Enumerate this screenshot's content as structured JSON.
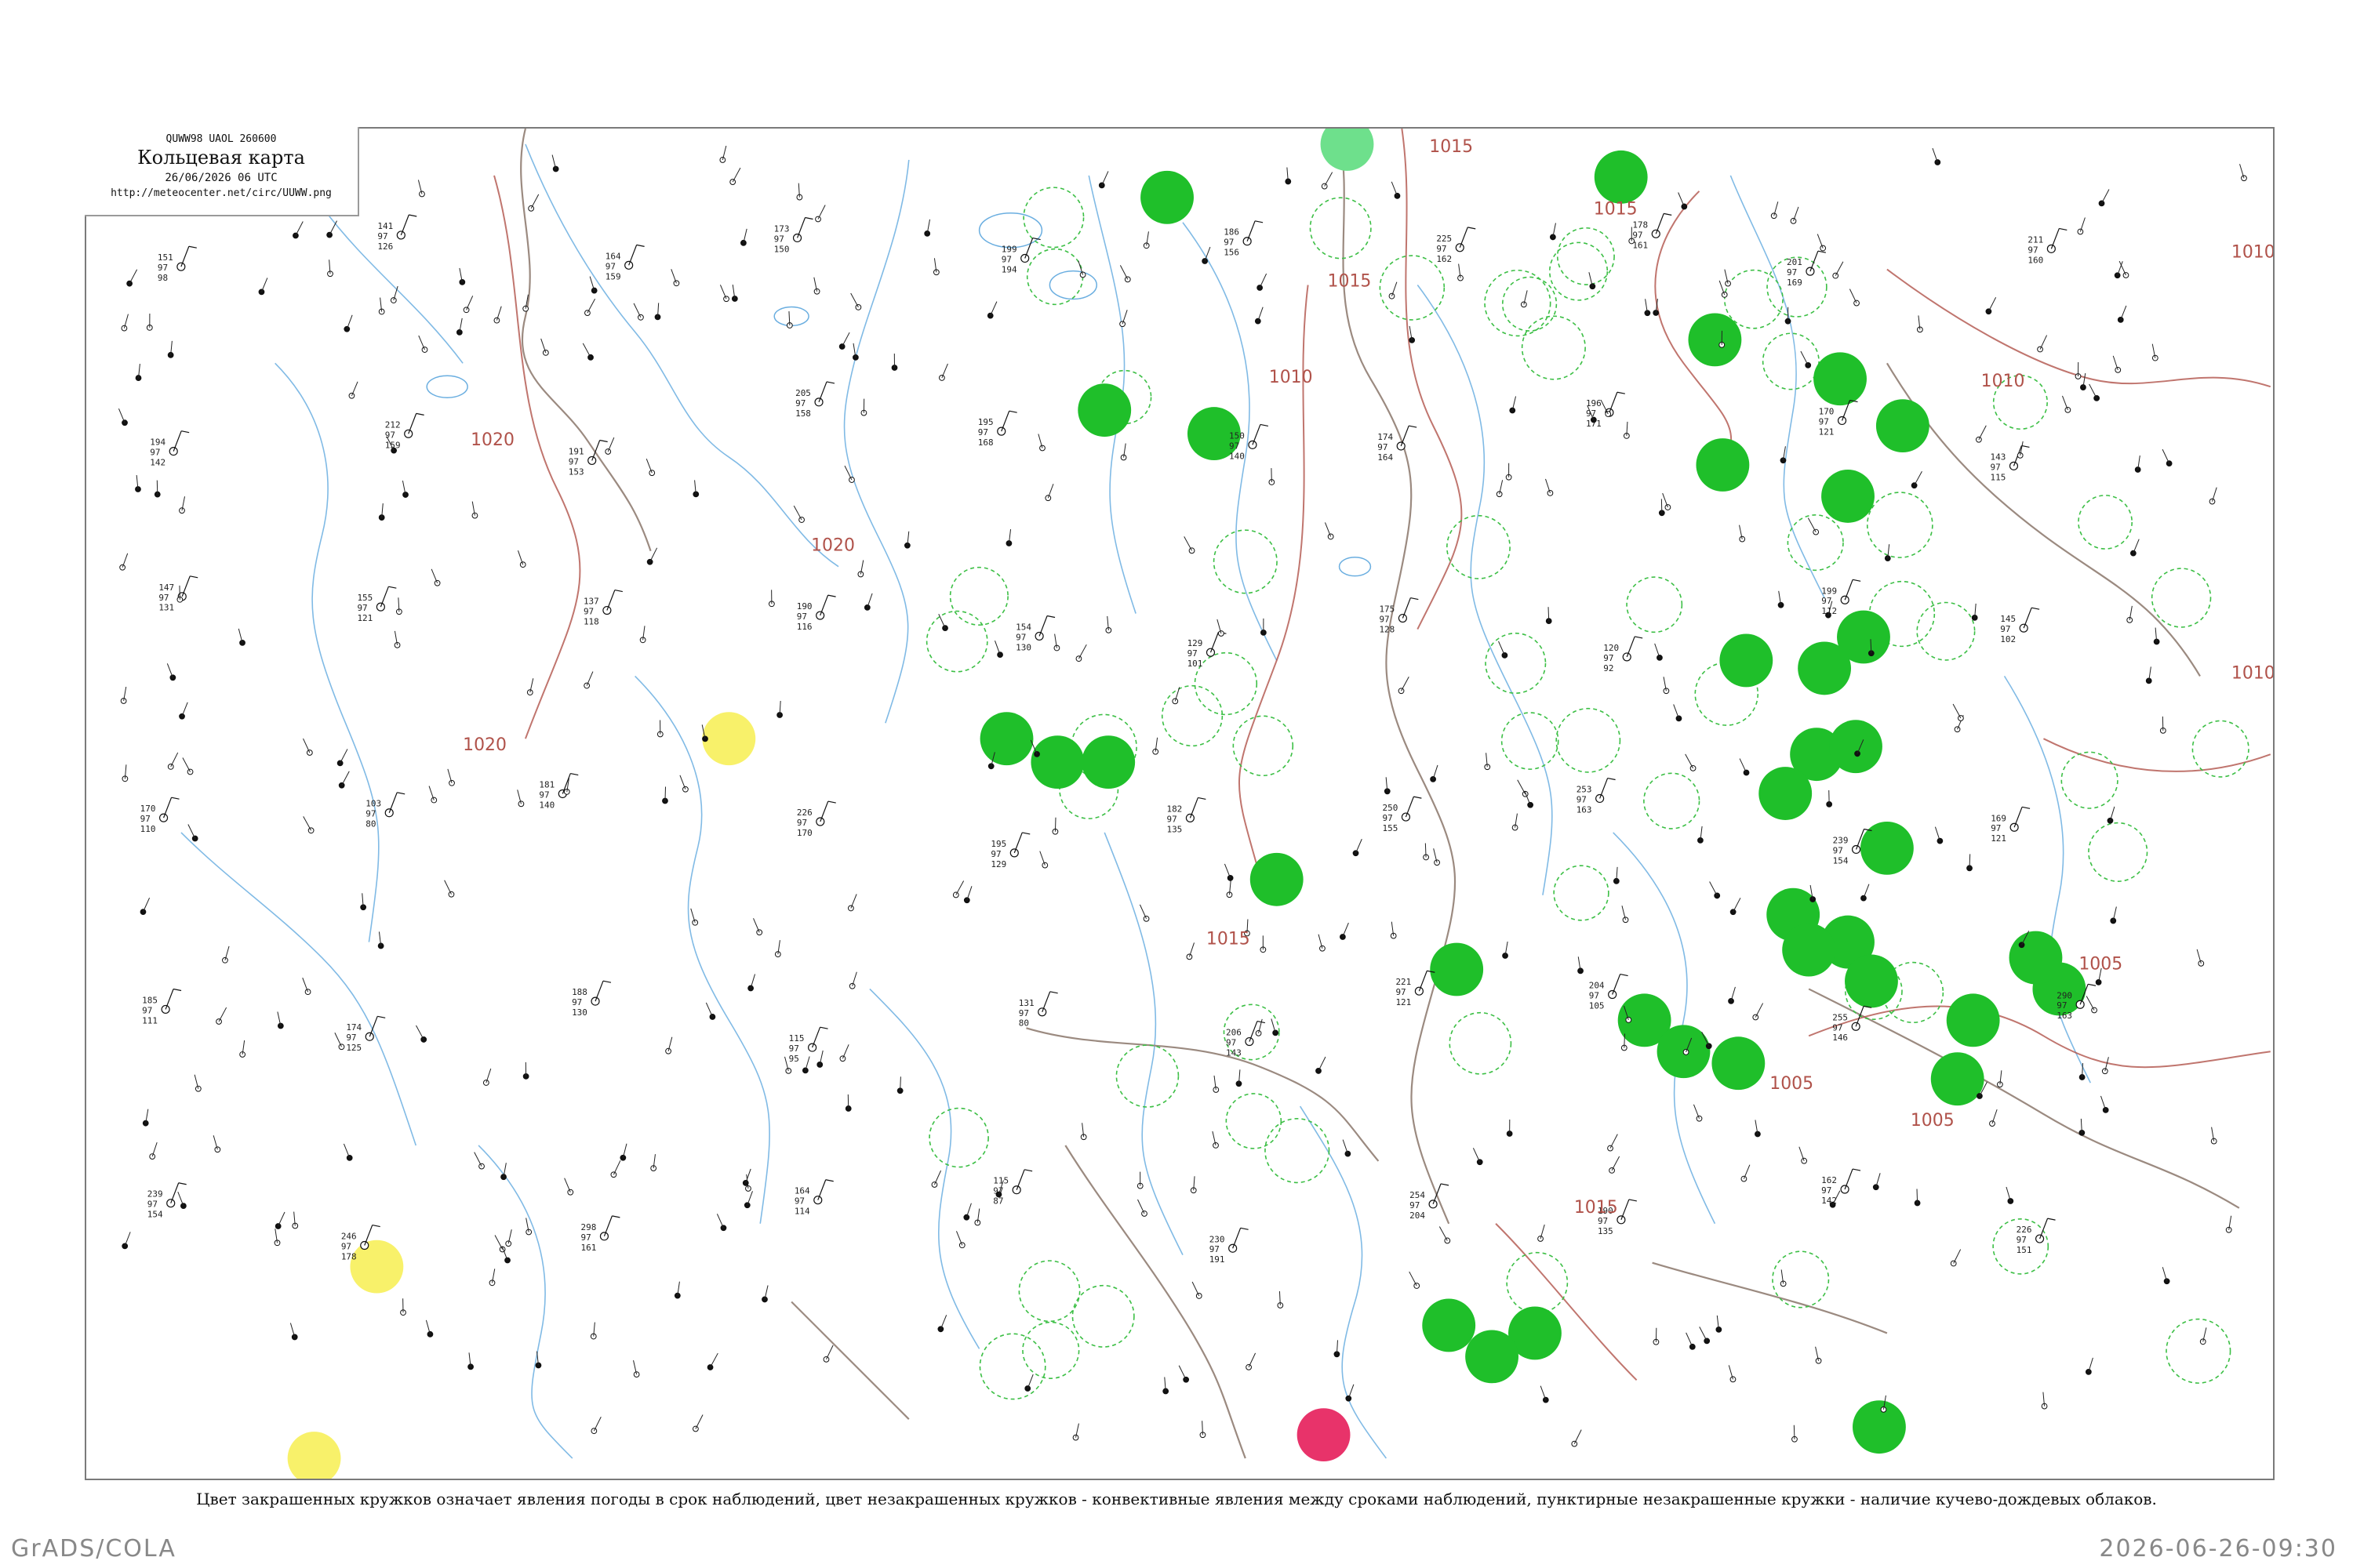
{
  "header": {
    "code": "QUWW98  UAOL  260600",
    "title": "Кольцевая карта",
    "date": "26/06/2026 06 UTC",
    "url": "http://meteocenter.net/circ/UUWW.png"
  },
  "legend": "Цвет закрашенных кружков означает явления погоды в срок наблюдений, цвет незакрашенных кружков - конвективные явления между сроками наблюдений, пунктирные незакрашенные кружки - наличие кучево-дождевых облаков.",
  "footer": {
    "left": "GrADS/COLA",
    "right": "2026-06-26-09:30"
  },
  "colors": {
    "isobar": "#b0524a",
    "water": "#6aaee0",
    "border": "#9b8a80",
    "fill_green": "#1fbf2a",
    "fill_yellow": "#f7f05a",
    "fill_red": "#e8336a",
    "fill_lightgreen": "#6ee08c",
    "cb_ring": "#3cbf45"
  },
  "isobars": {
    "labels": [
      {
        "text": "1020"
      },
      {
        "text": "1020"
      },
      {
        "text": "1020"
      },
      {
        "text": "1015"
      },
      {
        "text": "1015"
      },
      {
        "text": "1015"
      },
      {
        "text": "1015"
      },
      {
        "text": "1010"
      },
      {
        "text": "1010"
      },
      {
        "text": "1010"
      },
      {
        "text": "1005"
      },
      {
        "text": "1005"
      },
      {
        "text": "1005"
      },
      {
        "text": "1015"
      },
      {
        "text": "1010"
      }
    ]
  },
  "stations": [
    {
      "t": "151",
      "p": "97",
      "d": "98"
    },
    {
      "t": "141",
      "p": "97",
      "d": "126"
    },
    {
      "t": "164",
      "p": "97",
      "d": "159"
    },
    {
      "t": "173",
      "p": "97",
      "d": "150"
    },
    {
      "t": "199",
      "p": "97",
      "d": "194"
    },
    {
      "t": "186",
      "p": "97",
      "d": "156"
    },
    {
      "t": "225",
      "p": "97",
      "d": "162"
    },
    {
      "t": "178",
      "p": "97",
      "d": "161"
    },
    {
      "t": "201",
      "p": "97",
      "d": "169"
    },
    {
      "t": "211",
      "p": "97",
      "d": "160"
    },
    {
      "t": "194",
      "p": "97",
      "d": "142"
    },
    {
      "t": "212",
      "p": "97",
      "d": "159"
    },
    {
      "t": "191",
      "p": "97",
      "d": "153"
    },
    {
      "t": "205",
      "p": "97",
      "d": "158"
    },
    {
      "t": "195",
      "p": "97",
      "d": "168"
    },
    {
      "t": "150",
      "p": "97",
      "d": "140"
    },
    {
      "t": "174",
      "p": "97",
      "d": "164"
    },
    {
      "t": "196",
      "p": "97",
      "d": "171"
    },
    {
      "t": "170",
      "p": "97",
      "d": "121"
    },
    {
      "t": "143",
      "p": "97",
      "d": "115"
    },
    {
      "t": "147",
      "p": "97",
      "d": "131"
    },
    {
      "t": "155",
      "p": "97",
      "d": "121"
    },
    {
      "t": "137",
      "p": "97",
      "d": "118"
    },
    {
      "t": "190",
      "p": "97",
      "d": "116"
    },
    {
      "t": "154",
      "p": "97",
      "d": "130"
    },
    {
      "t": "129",
      "p": "97",
      "d": "101"
    },
    {
      "t": "175",
      "p": "97",
      "d": "128"
    },
    {
      "t": "120",
      "p": "97",
      "d": "92"
    },
    {
      "t": "199",
      "p": "97",
      "d": "112"
    },
    {
      "t": "145",
      "p": "97",
      "d": "102"
    },
    {
      "t": "170",
      "p": "97",
      "d": "110"
    },
    {
      "t": "103",
      "p": "97",
      "d": "80"
    },
    {
      "t": "181",
      "p": "97",
      "d": "140"
    },
    {
      "t": "226",
      "p": "97",
      "d": "170"
    },
    {
      "t": "195",
      "p": "97",
      "d": "129"
    },
    {
      "t": "182",
      "p": "97",
      "d": "135"
    },
    {
      "t": "250",
      "p": "97",
      "d": "155"
    },
    {
      "t": "253",
      "p": "97",
      "d": "163"
    },
    {
      "t": "239",
      "p": "97",
      "d": "154"
    },
    {
      "t": "169",
      "p": "97",
      "d": "121"
    },
    {
      "t": "185",
      "p": "97",
      "d": "111"
    },
    {
      "t": "174",
      "p": "97",
      "d": "125"
    },
    {
      "t": "188",
      "p": "97",
      "d": "130"
    },
    {
      "t": "115",
      "p": "97",
      "d": "95"
    },
    {
      "t": "131",
      "p": "97",
      "d": "80"
    },
    {
      "t": "206",
      "p": "97",
      "d": "143"
    },
    {
      "t": "221",
      "p": "97",
      "d": "121"
    },
    {
      "t": "204",
      "p": "97",
      "d": "105"
    },
    {
      "t": "255",
      "p": "97",
      "d": "146"
    },
    {
      "t": "290",
      "p": "97",
      "d": "163"
    },
    {
      "t": "239",
      "p": "97",
      "d": "154"
    },
    {
      "t": "246",
      "p": "97",
      "d": "178"
    },
    {
      "t": "298",
      "p": "97",
      "d": "161"
    },
    {
      "t": "164",
      "p": "97",
      "d": "114"
    },
    {
      "t": "115",
      "p": "97",
      "d": "87"
    },
    {
      "t": "230",
      "p": "97",
      "d": "191"
    },
    {
      "t": "254",
      "p": "97",
      "d": "204"
    },
    {
      "t": "190",
      "p": "97",
      "d": "135"
    },
    {
      "t": "162",
      "p": "97",
      "d": "142"
    },
    {
      "t": "226",
      "p": "97",
      "d": "151"
    }
  ],
  "fill_circles": [
    {
      "color": "green"
    },
    {
      "color": "green"
    },
    {
      "color": "green"
    },
    {
      "color": "green"
    },
    {
      "color": "green"
    },
    {
      "color": "green"
    },
    {
      "color": "green"
    },
    {
      "color": "green"
    },
    {
      "color": "green"
    },
    {
      "color": "green"
    },
    {
      "color": "green"
    },
    {
      "color": "green"
    },
    {
      "color": "green"
    },
    {
      "color": "green"
    },
    {
      "color": "green"
    },
    {
      "color": "green"
    },
    {
      "color": "green"
    },
    {
      "color": "green"
    },
    {
      "color": "green"
    },
    {
      "color": "green"
    },
    {
      "color": "green"
    },
    {
      "color": "green"
    },
    {
      "color": "green"
    },
    {
      "color": "green"
    },
    {
      "color": "green"
    },
    {
      "color": "green"
    },
    {
      "color": "green"
    },
    {
      "color": "green"
    },
    {
      "color": "green"
    },
    {
      "color": "green"
    },
    {
      "color": "green"
    },
    {
      "color": "green"
    },
    {
      "color": "green"
    },
    {
      "color": "green"
    },
    {
      "color": "green"
    },
    {
      "color": "green"
    },
    {
      "color": "yellow"
    },
    {
      "color": "yellow"
    },
    {
      "color": "yellow"
    },
    {
      "color": "red"
    },
    {
      "color": "lightgreen"
    }
  ]
}
